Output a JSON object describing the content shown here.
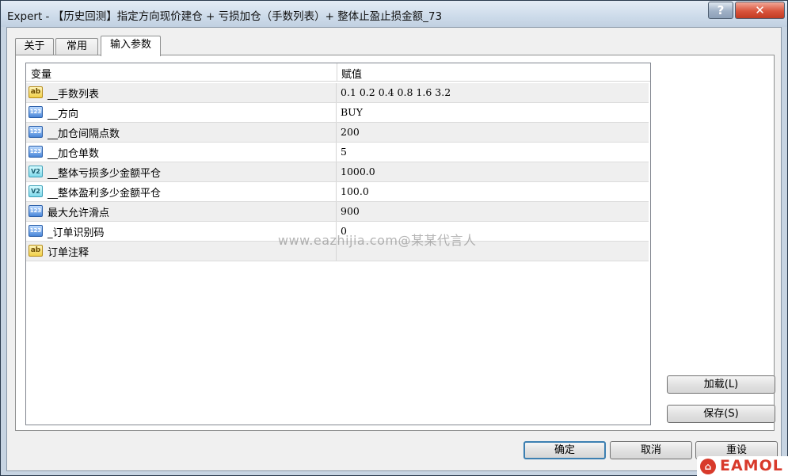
{
  "window": {
    "title": "Expert - 【历史回测】指定方向现价建仓 + 亏损加仓（手数列表）+ 整体止盈止损金额_73",
    "help_label": "?",
    "close_label": "✕"
  },
  "tabs": [
    {
      "label": "关于",
      "active": false
    },
    {
      "label": "常用",
      "active": false
    },
    {
      "label": "输入参数",
      "active": true
    }
  ],
  "grid": {
    "columns": {
      "variable": "变量",
      "value": "赋值"
    },
    "rows": [
      {
        "icon": "string-type-icon",
        "icon_text": "ab",
        "name": "__手数列表",
        "value": "0.1 0.2 0.4 0.8 1.6 3.2"
      },
      {
        "icon": "integer-type-icon",
        "icon_text": "123",
        "name": "__方向",
        "value": "BUY"
      },
      {
        "icon": "integer-type-icon",
        "icon_text": "123",
        "name": "__加仓间隔点数",
        "value": "200"
      },
      {
        "icon": "integer-type-icon",
        "icon_text": "123",
        "name": "__加仓单数",
        "value": "5"
      },
      {
        "icon": "double-type-icon",
        "icon_text": "V2",
        "name": "__整体亏损多少金额平仓",
        "value": "1000.0"
      },
      {
        "icon": "double-type-icon",
        "icon_text": "V2",
        "name": "__整体盈利多少金额平仓",
        "value": "100.0"
      },
      {
        "icon": "integer-type-icon",
        "icon_text": "123",
        "name": "最大允许滑点",
        "value": "900"
      },
      {
        "icon": "integer-type-icon",
        "icon_text": "123",
        "name": "_订单识别码",
        "value": "0"
      },
      {
        "icon": "string-type-icon",
        "icon_text": "ab",
        "name": "订单注释",
        "value": ""
      }
    ]
  },
  "side_buttons": {
    "load": "加载(L)",
    "save": "保存(S)"
  },
  "dialog_buttons": {
    "ok": "确定",
    "cancel": "取消",
    "reset": "重设"
  },
  "watermark": "www.eazhijia.com@某某代言人",
  "badge": {
    "mark": "⌂",
    "text": "EAMOL"
  }
}
